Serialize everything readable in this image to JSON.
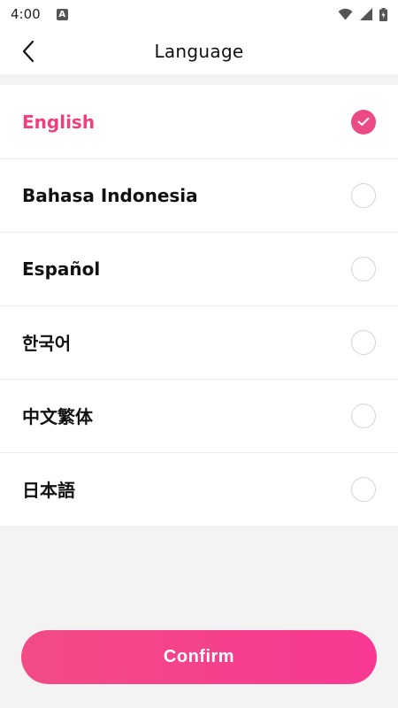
{
  "status_bar": {
    "time": "4:00",
    "notification_badge": "A",
    "icons": [
      "wifi-icon",
      "signal-icon",
      "battery-icon"
    ]
  },
  "header": {
    "title": "Language",
    "back_icon": "chevron-left-icon"
  },
  "languages": [
    {
      "label": "English",
      "selected": true
    },
    {
      "label": "Bahasa Indonesia",
      "selected": false
    },
    {
      "label": "Español",
      "selected": false
    },
    {
      "label": "한국어",
      "selected": false
    },
    {
      "label": "中文繁体",
      "selected": false
    },
    {
      "label": "日本語",
      "selected": false
    }
  ],
  "confirm": {
    "label": "Confirm"
  },
  "colors": {
    "accent": "#ec4a84",
    "background": "#f3f3f4",
    "list_background": "#ffffff"
  }
}
